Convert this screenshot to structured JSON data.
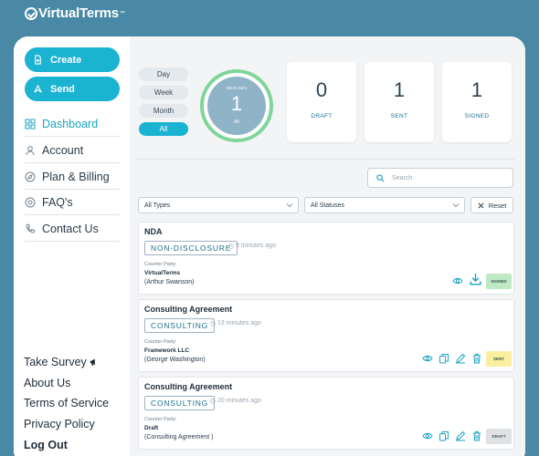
{
  "brand": {
    "name": "VirtualTerms",
    "trademark": "™"
  },
  "sidebar": {
    "create_label": "Create",
    "send_label": "Send",
    "nav": [
      {
        "label": "Dashboard",
        "icon": "dashboard-icon",
        "active": true
      },
      {
        "label": "Account",
        "icon": "user-icon"
      },
      {
        "label": "Plan & Billing",
        "icon": "compass-icon"
      },
      {
        "label": "FAQ's",
        "icon": "help-icon"
      },
      {
        "label": "Contact Us",
        "icon": "phone-icon"
      }
    ],
    "bottom_links": [
      {
        "label": "Take Survey",
        "icon": "megaphone-icon"
      },
      {
        "label": "About Us"
      },
      {
        "label": "Terms of Service"
      },
      {
        "label": "Privacy Policy"
      },
      {
        "label": "Log Out"
      }
    ]
  },
  "dashboard": {
    "periods": [
      "Day",
      "Week",
      "Month",
      "All"
    ],
    "active_period": "All",
    "ring": {
      "caption": "NDAs Sent",
      "value": "1",
      "sub": "All"
    },
    "stats": [
      {
        "value": "0",
        "label": "DRAFT"
      },
      {
        "value": "1",
        "label": "SENT"
      },
      {
        "value": "1",
        "label": "SIGNED"
      }
    ],
    "search_placeholder": "Search",
    "filters": {
      "type": "All Types",
      "status": "All Statuses",
      "reset": "Reset"
    }
  },
  "documents": [
    {
      "title": "NDA",
      "tag": "NON-DISCLOSURE",
      "time": "9 minutes ago",
      "counter_party_label": "Counter Party:",
      "party": "VirtualTerms",
      "contact": "(Arthur Swanson)",
      "status": "SIGNED"
    },
    {
      "title": "Consulting Agreement",
      "tag": "CONSULTING",
      "time": "13 minutes ago",
      "counter_party_label": "Counter Party:",
      "party": "Framework LLC",
      "contact": "(George Washington)",
      "status": "SENT"
    },
    {
      "title": "Consulting Agreement",
      "tag": "CONSULTING",
      "time": "20 minutes ago",
      "counter_party_label": "Counter Party:",
      "party": "Draft",
      "contact": "(Consulting Agreement )",
      "status": "DRAFT"
    }
  ],
  "colors": {
    "background": "#4a89a5",
    "accent": "#1bb3d2",
    "ring": "#7fd59a",
    "signed": "#bfe8c5",
    "sent": "#faeea0",
    "draft": "#dfe2e5"
  }
}
